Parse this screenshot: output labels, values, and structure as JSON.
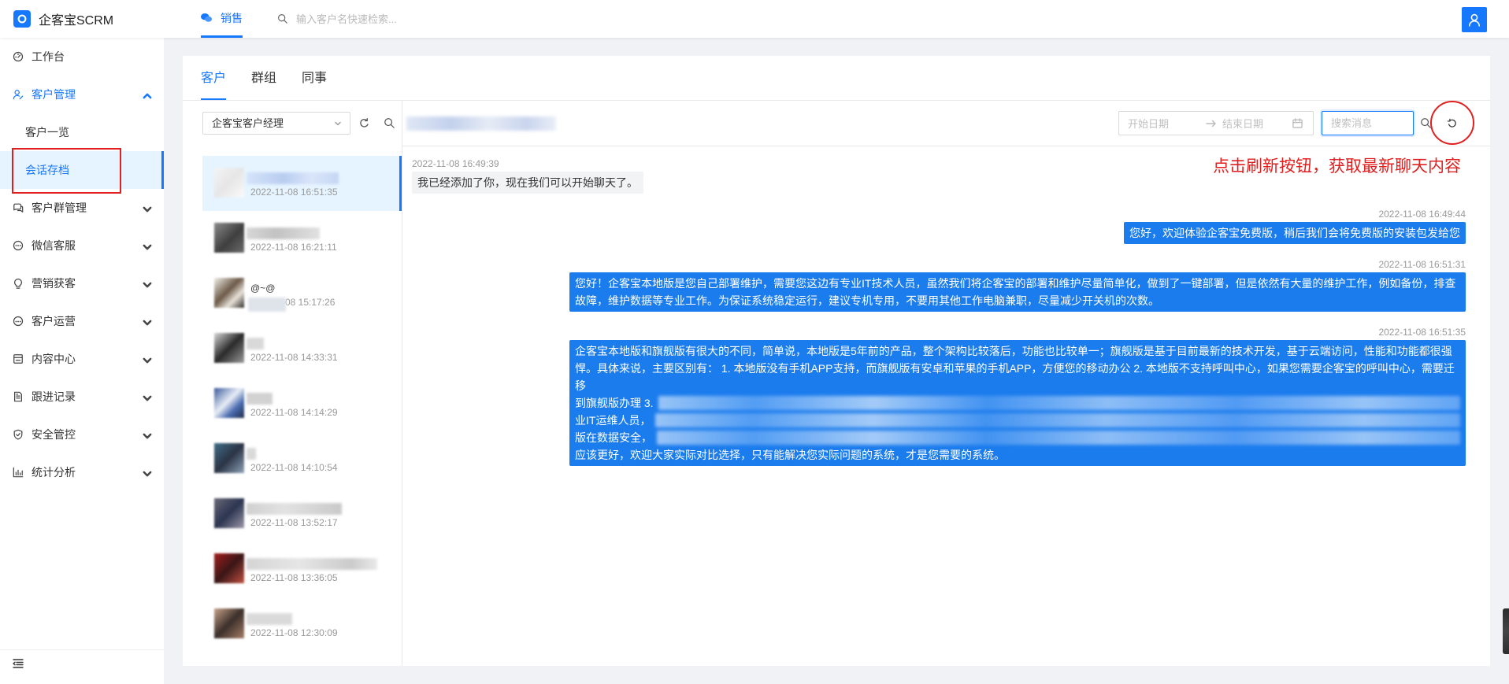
{
  "header": {
    "app_name": "企客宝SCRM",
    "tab": "销售",
    "search_placeholder": "输入客户名快速检索..."
  },
  "sidebar": {
    "items": [
      {
        "label": "工作台",
        "icon": "dashboard-icon"
      },
      {
        "label": "客户管理",
        "icon": "user-icon"
      },
      {
        "label": "客户一览"
      },
      {
        "label": "会话存档"
      },
      {
        "label": "客户群管理",
        "icon": "group-chat-icon"
      },
      {
        "label": "微信客服",
        "icon": "message-icon"
      },
      {
        "label": "营销获客",
        "icon": "bulb-icon"
      },
      {
        "label": "客户运营",
        "icon": "operation-icon"
      },
      {
        "label": "内容中心",
        "icon": "store-icon"
      },
      {
        "label": "跟进记录",
        "icon": "record-icon"
      },
      {
        "label": "安全管控",
        "icon": "shield-icon"
      },
      {
        "label": "统计分析",
        "icon": "bar-chart-icon"
      }
    ]
  },
  "tabs": [
    "客户",
    "群组",
    "同事"
  ],
  "filter": {
    "selected": "企客宝客户经理"
  },
  "customers": [
    {
      "time": "2022-11-08 16:51:35"
    },
    {
      "time": "2022-11-08 16:21:11"
    },
    {
      "name": "@~@",
      "time": "-08 15:17:26"
    },
    {
      "time": "2022-11-08 14:33:31"
    },
    {
      "time": "2022-11-08 14:14:29"
    },
    {
      "time": "2022-11-08 14:10:54"
    },
    {
      "time": "2022-11-08 13:52:17"
    },
    {
      "time": "2022-11-08 13:36:05"
    },
    {
      "time": "2022-11-08 12:30:09"
    }
  ],
  "toolbar": {
    "start_placeholder": "开始日期",
    "end_placeholder": "结束日期",
    "search_placeholder": "搜索消息"
  },
  "messages": [
    {
      "time": "2022-11-08 16:49:39",
      "text": "我已经添加了你，现在我们可以开始聊天了。"
    },
    {
      "time": "2022-11-08 16:49:44",
      "text": "您好，欢迎体验企客宝免费版，稍后我们会将免费版的安装包发给您"
    },
    {
      "time": "2022-11-08 16:51:31",
      "text": "您好！企客宝本地版是您自己部署维护，需要您这边有专业IT技术人员，虽然我们将企客宝的部署和维护尽量简单化，做到了一键部署，但是依然有大量的维护工作，例如备份，排查故障，维护数据等专业工作。为保证系统稳定运行，建议专机专用，不要用其他工作电脑兼职，尽量减少开关机的次数。"
    },
    {
      "time": "2022-11-08 16:51:35",
      "lines": [
        "企客宝本地版和旗舰版有很大的不同，简单说，本地版是5年前的产品，整个架构比较落后，功能也比较单一；旗舰版是基于目前最新的技术开发，基于云端访问，性能和功能都很强",
        "悍。具体来说，主要区别有： 1. 本地版没有手机APP支持，而旗舰版有安卓和苹果的手机APP，方便您的移动办公 2. 本地版不支持呼叫中心，如果您需要企客宝的呼叫中心，需要迁移",
        "到旗舰版办理 3.",
        "业IT运维人员，",
        "版在数据安全，",
        "应该更好，欢迎大家实际对比选择，只有能解决您实际问题的系统，才是您需要的系统。"
      ]
    }
  ],
  "annotation": {
    "text": "点击刷新按钮，获取最新聊天内容"
  },
  "colors": {
    "accent": "#1677ff",
    "bubble_outgoing": "#1b7ced",
    "bubble_incoming": "#f2f3f5",
    "annotation": "#e02020"
  }
}
